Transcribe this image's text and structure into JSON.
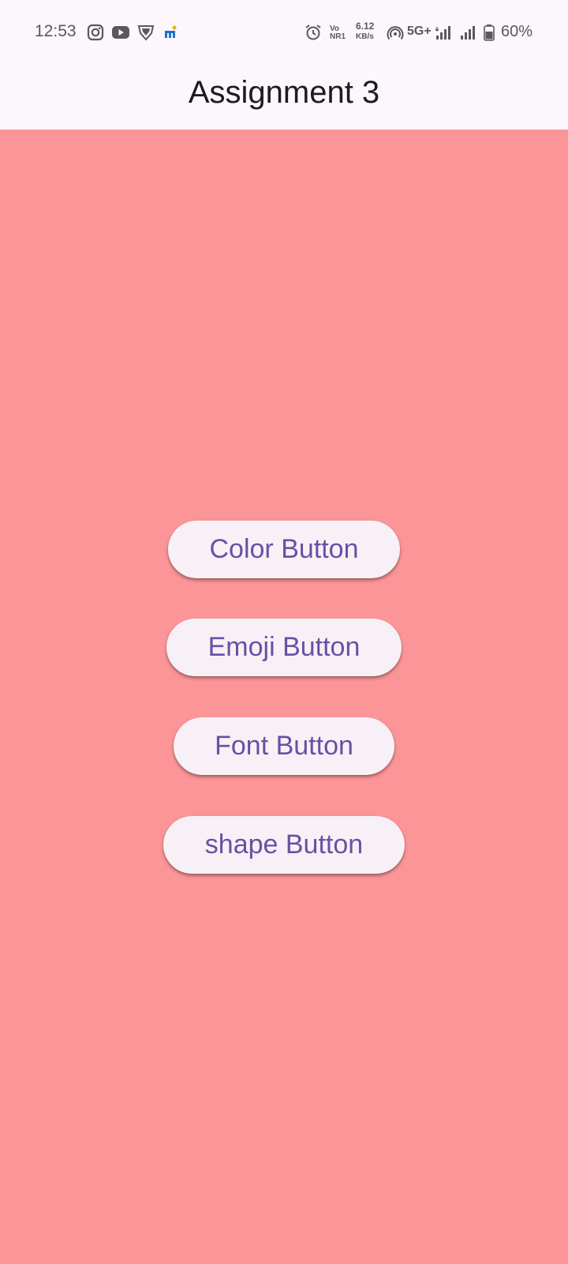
{
  "status_bar": {
    "time": "12:53",
    "left_icons": [
      "instagram-icon",
      "youtube-icon",
      "vpn-shield-icon",
      "app-notification-icon"
    ],
    "volte_top": "Vo",
    "volte_bottom": "NR1",
    "speed_value": "6.12",
    "speed_unit": "KB/s",
    "network_type": "5G+",
    "battery_percent": "60%"
  },
  "app_bar": {
    "title": "Assignment 3"
  },
  "buttons": [
    {
      "label": "Color Button"
    },
    {
      "label": "Emoji Button"
    },
    {
      "label": "Font Button"
    },
    {
      "label": "shape Button"
    }
  ],
  "colors": {
    "background": "#fc9597",
    "button_bg": "#f7f1f7",
    "button_text": "#6a4fa5",
    "app_bar_bg": "#fcf6fd"
  }
}
